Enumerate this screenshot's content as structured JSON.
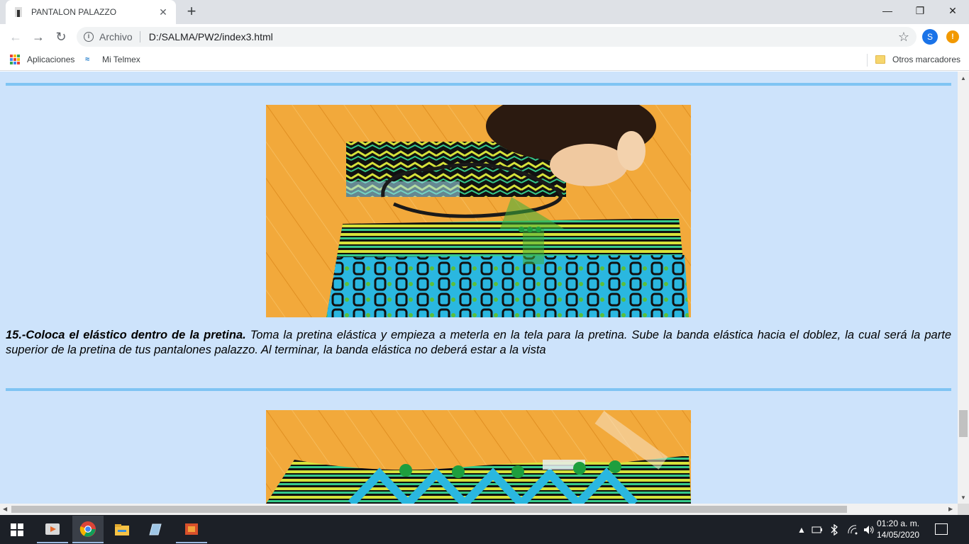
{
  "browser": {
    "tab_title": "PANTALON PALAZZO",
    "tab_close": "✕",
    "new_tab": "+",
    "window_controls": {
      "minimize": "—",
      "restore": "❐",
      "close": "✕"
    },
    "nav": {
      "back": "←",
      "forward": "→",
      "reload": "↻"
    },
    "address": {
      "scheme_label": "Archivo",
      "url": "D:/SALMA/PW2/index3.html"
    },
    "star": "☆",
    "profile_initial": "S",
    "alert_symbol": "!"
  },
  "bookmarks": {
    "apps_label": "Aplicaciones",
    "telmex_label": "Mi Telmex",
    "other_label": "Otros marcadores"
  },
  "page": {
    "step15": {
      "heading": "15.-Coloca el elástico dentro de la pretina.",
      "body": " Toma la pretina elástica y empieza a meterla en la tela para la pretina. Sube la banda elástica hacia el doblez, la cual será la parte superior de la pretina de tus pantalones palazzo. Al terminar, la banda elástica no deberá estar a la vista"
    }
  },
  "taskbar": {
    "time": "01:20 a. m.",
    "date": "14/05/2020",
    "tray_chevron": "▲"
  },
  "colors": {
    "page_bg": "#cde3fb",
    "rule": "#7fc4f3",
    "floor": "#f2a93b",
    "fabric_cyan": "#2ab7e0",
    "fabric_yellow": "#d6e23a",
    "fabric_green": "#35c98a",
    "marker_green": "#1e9e3e"
  }
}
